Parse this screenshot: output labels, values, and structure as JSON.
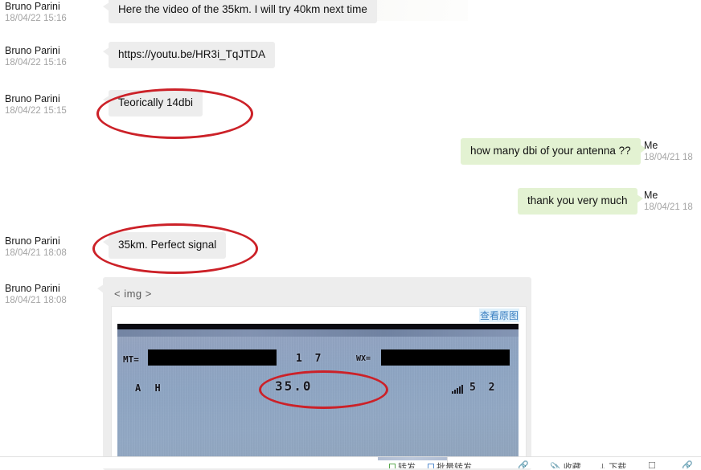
{
  "app": {
    "type": "chat-transcript",
    "accent_red": "#cc2128",
    "incoming_bubble_color": "#ededed",
    "outgoing_bubble_color": "#e3f2d2",
    "link_color": "#3a7fc1"
  },
  "messages": [
    {
      "id": "m1",
      "side": "incoming",
      "sender": "Bruno Parini",
      "time": "18/04/22 15:16",
      "text": "Here the video of the 35km. I will try 40km next time"
    },
    {
      "id": "m2",
      "side": "incoming",
      "sender": "Bruno Parini",
      "time": "18/04/22 15:16",
      "text": "https://youtu.be/HR3i_TqJTDA"
    },
    {
      "id": "m3",
      "side": "incoming",
      "sender": "Bruno Parini",
      "time": "18/04/22 15:15",
      "text": "Teorically 14dbi",
      "annotated": true
    },
    {
      "id": "m4",
      "side": "outgoing",
      "sender": "Me",
      "time": "18/04/21 18",
      "text": "how many dbi of your antenna ??"
    },
    {
      "id": "m5",
      "side": "outgoing",
      "sender": "Me",
      "time": "18/04/21 18",
      "text": "thank you very much"
    },
    {
      "id": "m6",
      "side": "incoming",
      "sender": "Bruno Parini",
      "time": "18/04/21 18:08",
      "text": "35km. Perfect signal",
      "annotated": true
    },
    {
      "id": "m7",
      "side": "incoming",
      "sender": "Bruno Parini",
      "time": "18/04/21 18:08",
      "text": "< img >",
      "attachment": true
    }
  ],
  "attachment": {
    "placeholder_label": "< img >",
    "view_original_label": "查看原图",
    "photo": {
      "description": "photograph of a radio transceiver LCD display",
      "left_label": "MT=",
      "right_label": "WX=",
      "left_redacted": true,
      "right_redacted": true,
      "center_number": "1 7",
      "mode_indicators": "A H",
      "circled_value": "35.0",
      "signal_value": "5 2",
      "signal_icon": "signal-bars-icon"
    }
  },
  "annotations": [
    {
      "target": "Teorically 14dbi",
      "shape": "ellipse",
      "color": "#cc2128"
    },
    {
      "target": "35km. Perfect signal",
      "shape": "ellipse",
      "color": "#cc2128"
    },
    {
      "target": "35.0",
      "shape": "ellipse",
      "color": "#cc2128"
    }
  ],
  "bottom_bar": {
    "items": [
      {
        "icon": "green-checkbox-icon",
        "label": "转发"
      },
      {
        "icon": "blue-checkbox-icon",
        "label": "批量转发"
      },
      {
        "icon": "link-icon",
        "label": ""
      },
      {
        "icon": "paperclip-icon",
        "label": "收藏"
      },
      {
        "icon": "download-icon",
        "label": "下载"
      },
      {
        "icon": "window-icon",
        "label": ""
      },
      {
        "icon": "link-icon",
        "label": ""
      }
    ]
  }
}
